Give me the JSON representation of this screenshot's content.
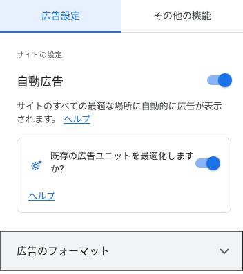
{
  "tabs": [
    {
      "label": "広告設定",
      "active": true
    },
    {
      "label": "その他の機能",
      "active": false
    }
  ],
  "site_settings": {
    "section_label": "サイトの設定",
    "auto_ads_title": "自動広告",
    "auto_ads_enabled": true,
    "description": "サイトのすべての最適な場所に自動的に広告が表示されます。",
    "help_link": "ヘルプ"
  },
  "optimize_card": {
    "icon": "gear-sparkle-icon",
    "text": "既存の広告ユニットを最適化しますか？",
    "enabled": true,
    "help_link": "ヘルプ"
  },
  "accordion": {
    "title": "広告のフォーマット",
    "icon": "chevron-down-icon"
  },
  "colors": {
    "accent": "#1a73e8",
    "accent_light": "#8ab4f8",
    "tab_active_bg": "#e8f0fe"
  }
}
